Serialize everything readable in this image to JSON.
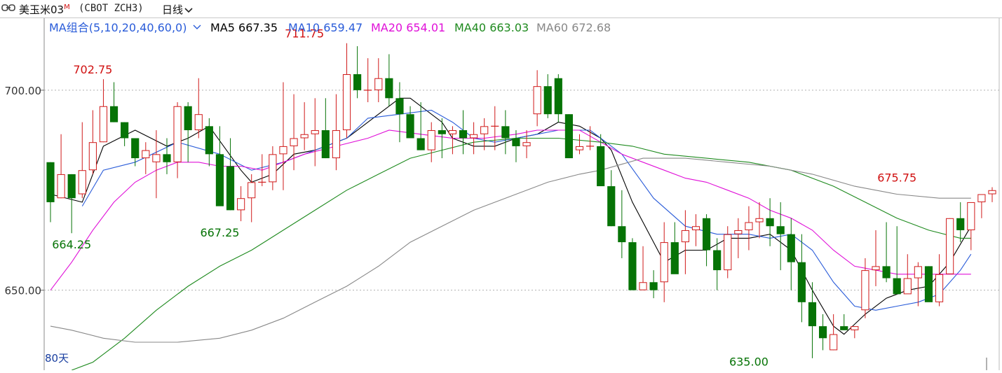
{
  "header": {
    "title": "美玉米03",
    "title_mark": "M",
    "contract": "(CBOT ZCH3)",
    "period": "日线"
  },
  "legend": {
    "ma_selector": "MA组合(5,10,20,40,60,0)",
    "items": [
      {
        "label": "MA5",
        "value": "667.35",
        "color": "#000000"
      },
      {
        "label": "MA10",
        "value": "659.47",
        "color": "#2a5cd9"
      },
      {
        "label": "MA20",
        "value": "654.01",
        "color": "#e010d8"
      },
      {
        "label": "MA40",
        "value": "663.03",
        "color": "#1e8a1e"
      },
      {
        "label": "MA60",
        "value": "672.68",
        "color": "#888888"
      }
    ]
  },
  "footer": {
    "days_label": "80天"
  },
  "chart_data": {
    "type": "candlestick",
    "y_ticks": [
      "700.00",
      "650.00"
    ],
    "ylim": [
      630,
      718
    ],
    "grid": "horizontal-dotted",
    "up_color": "#d01a1a",
    "down_color": "#067306",
    "annotations": [
      {
        "text": "702.75",
        "bar": 4,
        "value": 702.75,
        "kind": "high"
      },
      {
        "text": "711.75",
        "bar": 24,
        "value": 711.75,
        "kind": "high"
      },
      {
        "text": "664.25",
        "bar": 2,
        "value": 664.25,
        "kind": "low"
      },
      {
        "text": "667.25",
        "bar": 16,
        "value": 667.25,
        "kind": "low"
      },
      {
        "text": "635.00",
        "bar": 66,
        "value": 635.0,
        "kind": "low"
      },
      {
        "text": "675.75",
        "bar": 80,
        "value": 675.75,
        "kind": "high"
      }
    ],
    "candles": [
      [
        682,
        682,
        667,
        672
      ],
      [
        673,
        689,
        673,
        679
      ],
      [
        679,
        679,
        664.25,
        673
      ],
      [
        674,
        692,
        673,
        680
      ],
      [
        680,
        695,
        679,
        687
      ],
      [
        687,
        702.75,
        687,
        696
      ],
      [
        696,
        702,
        692,
        692
      ],
      [
        692,
        692,
        686,
        688
      ],
      [
        688,
        688,
        681,
        683
      ],
      [
        683,
        687,
        679,
        685
      ],
      [
        682,
        690,
        673,
        684
      ],
      [
        684,
        688,
        679,
        682
      ],
      [
        682,
        697,
        678,
        696
      ],
      [
        696,
        697,
        682,
        690
      ],
      [
        690,
        703,
        688,
        694
      ],
      [
        691,
        693,
        681,
        684
      ],
      [
        684,
        691,
        679,
        671
      ],
      [
        681,
        688,
        670,
        670
      ],
      [
        670,
        676,
        667.25,
        673
      ],
      [
        673,
        679,
        667,
        677
      ],
      [
        677,
        684,
        676,
        677
      ],
      [
        677,
        686,
        675,
        684
      ],
      [
        684,
        702,
        675,
        686
      ],
      [
        686,
        699,
        680,
        688
      ],
      [
        688,
        697,
        685,
        689
      ],
      [
        689,
        698,
        681,
        690
      ],
      [
        690,
        698,
        683,
        683
      ],
      [
        683,
        699,
        680,
        690
      ],
      [
        690,
        711.75,
        688,
        704
      ],
      [
        704,
        711,
        698,
        700
      ],
      [
        700,
        708,
        697,
        700
      ],
      [
        700,
        708,
        697,
        703
      ],
      [
        703,
        709,
        696,
        698
      ],
      [
        698,
        702,
        687,
        694
      ],
      [
        694,
        696,
        689,
        688
      ],
      [
        688,
        697,
        685,
        685
      ],
      [
        685,
        692,
        682,
        690
      ],
      [
        690,
        693,
        683,
        689
      ],
      [
        689,
        691,
        684,
        690
      ],
      [
        690,
        695,
        684,
        688
      ],
      [
        688,
        692,
        684,
        689
      ],
      [
        689,
        693,
        685,
        691
      ],
      [
        691,
        696,
        685,
        691
      ],
      [
        691,
        695,
        684,
        688
      ],
      [
        688,
        690,
        682,
        686
      ],
      [
        686,
        690,
        683,
        687
      ],
      [
        694,
        705,
        691,
        701
      ],
      [
        701,
        704,
        693,
        694
      ],
      [
        703,
        704,
        692,
        694
      ],
      [
        694,
        694,
        683,
        683
      ],
      [
        685,
        689,
        684,
        686
      ],
      [
        686,
        691,
        685,
        686
      ],
      [
        686,
        689,
        678,
        676
      ],
      [
        676,
        680,
        666,
        666
      ],
      [
        666,
        675,
        658,
        662
      ],
      [
        662,
        663,
        650,
        650
      ],
      [
        650,
        661,
        650,
        652
      ],
      [
        652,
        655,
        648,
        650
      ],
      [
        652,
        667,
        647,
        662
      ],
      [
        662,
        667,
        655,
        654
      ],
      [
        662,
        670,
        654,
        665
      ],
      [
        665,
        669,
        661,
        666
      ],
      [
        668,
        669,
        656,
        660
      ],
      [
        660,
        663,
        650,
        655
      ],
      [
        655,
        666,
        653,
        664
      ],
      [
        664,
        668,
        658,
        665
      ],
      [
        665,
        671,
        660,
        667
      ],
      [
        667,
        672,
        663,
        668
      ],
      [
        668,
        673,
        661,
        666
      ],
      [
        666,
        672,
        655,
        664
      ],
      [
        664,
        668,
        650,
        657
      ],
      [
        657,
        664,
        642,
        647
      ],
      [
        647,
        652,
        633,
        641
      ],
      [
        641,
        644,
        635,
        638
      ],
      [
        635,
        644,
        635,
        639
      ],
      [
        641,
        644,
        640,
        640
      ],
      [
        640,
        641,
        638,
        641
      ],
      [
        645,
        658,
        643,
        655
      ],
      [
        655,
        665,
        651,
        656
      ],
      [
        656,
        667,
        652,
        653
      ],
      [
        653,
        666,
        650,
        649
      ],
      [
        649,
        659,
        650,
        653
      ],
      [
        653,
        657,
        646,
        656
      ],
      [
        656,
        656,
        649,
        647
      ],
      [
        647,
        659,
        646,
        654
      ],
      [
        654,
        668,
        655,
        668
      ],
      [
        668,
        672,
        662,
        665
      ],
      [
        665,
        665,
        660,
        672
      ],
      [
        672,
        674,
        668,
        674
      ],
      [
        674,
        675.75,
        672,
        675
      ]
    ],
    "ma_lines": [
      {
        "name": "MA5",
        "color": "#000000",
        "points": [
          [
            0,
            674
          ],
          [
            3,
            672
          ],
          [
            5,
            686
          ],
          [
            8,
            690
          ],
          [
            11,
            686
          ],
          [
            13,
            688
          ],
          [
            15,
            691
          ],
          [
            18,
            680
          ],
          [
            19,
            677
          ],
          [
            21,
            679
          ],
          [
            23,
            684
          ],
          [
            25,
            685
          ],
          [
            28,
            688
          ],
          [
            30,
            692
          ],
          [
            33,
            698
          ],
          [
            34,
            698
          ],
          [
            37,
            692
          ],
          [
            38,
            688
          ],
          [
            40,
            686
          ],
          [
            42,
            686
          ],
          [
            44,
            688
          ],
          [
            46,
            689
          ],
          [
            48,
            692
          ],
          [
            50,
            691
          ],
          [
            52,
            688
          ],
          [
            53,
            685
          ],
          [
            55,
            672
          ],
          [
            57,
            662
          ],
          [
            58,
            657
          ],
          [
            60,
            660
          ],
          [
            62,
            660
          ],
          [
            64,
            663
          ],
          [
            66,
            663
          ],
          [
            68,
            664
          ],
          [
            70,
            660
          ],
          [
            72,
            650
          ],
          [
            74,
            641
          ],
          [
            75,
            639
          ],
          [
            77,
            644
          ],
          [
            79,
            648
          ],
          [
            81,
            650
          ],
          [
            83,
            651
          ],
          [
            85,
            657
          ],
          [
            87,
            666
          ]
        ]
      },
      {
        "name": "MA10",
        "color": "#2a5cd9",
        "points": [
          [
            3,
            671
          ],
          [
            5,
            680
          ],
          [
            8,
            682
          ],
          [
            12,
            687
          ],
          [
            16,
            684
          ],
          [
            19,
            680
          ],
          [
            22,
            682
          ],
          [
            25,
            685
          ],
          [
            28,
            688
          ],
          [
            30,
            693
          ],
          [
            33,
            694
          ],
          [
            36,
            695
          ],
          [
            38,
            692
          ],
          [
            40,
            688
          ],
          [
            42,
            687
          ],
          [
            44,
            688
          ],
          [
            46,
            689
          ],
          [
            48,
            690
          ],
          [
            51,
            690
          ],
          [
            54,
            684
          ],
          [
            57,
            673
          ],
          [
            60,
            666
          ],
          [
            63,
            664
          ],
          [
            66,
            664
          ],
          [
            68,
            663
          ],
          [
            70,
            664
          ],
          [
            72,
            660
          ],
          [
            74,
            652
          ],
          [
            76,
            646
          ],
          [
            78,
            645
          ],
          [
            80,
            646
          ],
          [
            82,
            647
          ],
          [
            84,
            649
          ],
          [
            86,
            655
          ],
          [
            87,
            659
          ]
        ]
      },
      {
        "name": "MA20",
        "color": "#e010d8",
        "points": [
          [
            0,
            650
          ],
          [
            2,
            657
          ],
          [
            4,
            665
          ],
          [
            6,
            672
          ],
          [
            8,
            677
          ],
          [
            10,
            680
          ],
          [
            12,
            682
          ],
          [
            14,
            682
          ],
          [
            16,
            681
          ],
          [
            18,
            681
          ],
          [
            20,
            680
          ],
          [
            22,
            682
          ],
          [
            24,
            684
          ],
          [
            27,
            686
          ],
          [
            30,
            688
          ],
          [
            32,
            690
          ],
          [
            35,
            689
          ],
          [
            38,
            688
          ],
          [
            41,
            688
          ],
          [
            44,
            689
          ],
          [
            46,
            690
          ],
          [
            48,
            690
          ],
          [
            50,
            690
          ],
          [
            52,
            687
          ],
          [
            54,
            684
          ],
          [
            56,
            682
          ],
          [
            58,
            680
          ],
          [
            60,
            678
          ],
          [
            62,
            677
          ],
          [
            64,
            675
          ],
          [
            66,
            673
          ],
          [
            68,
            670
          ],
          [
            70,
            668
          ],
          [
            72,
            665
          ],
          [
            74,
            660
          ],
          [
            76,
            656
          ],
          [
            78,
            655
          ],
          [
            80,
            654
          ],
          [
            82,
            654
          ],
          [
            84,
            654
          ],
          [
            86,
            654
          ],
          [
            87,
            654
          ]
        ]
      },
      {
        "name": "MA40",
        "color": "#1e8a1e",
        "points": [
          [
            2,
            630
          ],
          [
            4,
            632
          ],
          [
            7,
            638
          ],
          [
            10,
            645
          ],
          [
            13,
            651
          ],
          [
            16,
            656
          ],
          [
            19,
            660
          ],
          [
            22,
            665
          ],
          [
            25,
            670
          ],
          [
            28,
            675
          ],
          [
            31,
            679
          ],
          [
            34,
            683
          ],
          [
            37,
            685
          ],
          [
            40,
            687
          ],
          [
            44,
            688
          ],
          [
            48,
            688
          ],
          [
            52,
            687
          ],
          [
            55,
            686
          ],
          [
            58,
            684
          ],
          [
            62,
            683
          ],
          [
            66,
            682
          ],
          [
            70,
            680
          ],
          [
            74,
            676
          ],
          [
            77,
            672
          ],
          [
            80,
            668
          ],
          [
            83,
            665
          ],
          [
            86,
            663
          ],
          [
            87,
            663
          ]
        ]
      },
      {
        "name": "MA60",
        "color": "#888888",
        "points": [
          [
            0,
            641
          ],
          [
            2,
            640
          ],
          [
            5,
            638
          ],
          [
            8,
            637
          ],
          [
            12,
            637
          ],
          [
            16,
            638
          ],
          [
            19,
            640
          ],
          [
            22,
            643
          ],
          [
            25,
            647
          ],
          [
            28,
            651
          ],
          [
            31,
            656
          ],
          [
            34,
            662
          ],
          [
            37,
            666
          ],
          [
            40,
            670
          ],
          [
            44,
            674
          ],
          [
            47,
            677
          ],
          [
            50,
            679
          ],
          [
            52,
            680
          ],
          [
            56,
            683
          ],
          [
            60,
            683
          ],
          [
            64,
            682
          ],
          [
            68,
            681
          ],
          [
            72,
            679
          ],
          [
            76,
            676
          ],
          [
            80,
            674
          ],
          [
            84,
            673
          ],
          [
            87,
            673
          ]
        ]
      }
    ]
  }
}
